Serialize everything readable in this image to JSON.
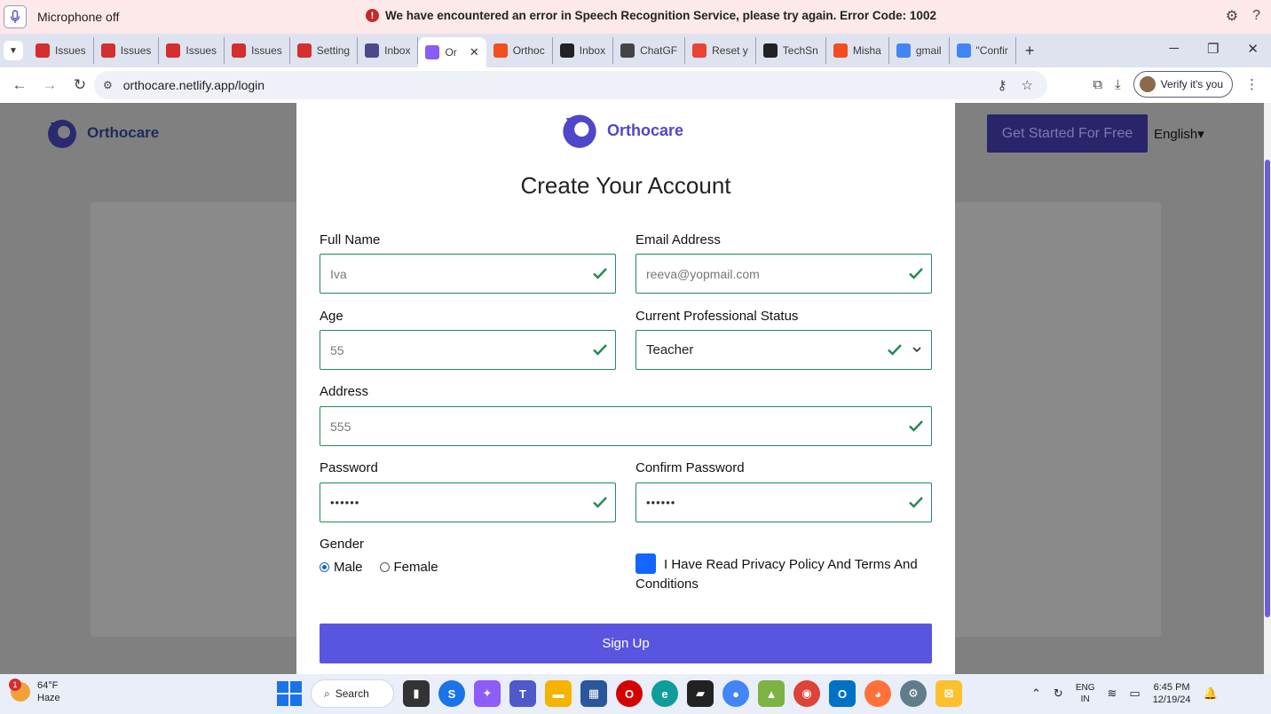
{
  "speech": {
    "mic_label": "Microphone off",
    "error_message": "We have encountered an error in Speech Recognition Service, please try again. Error Code: 1002",
    "error_badge": "!",
    "help_label": "?"
  },
  "tabs": [
    {
      "label": "Issues",
      "icon": "issues-icon",
      "color": "#d32f2f"
    },
    {
      "label": "Issues",
      "icon": "issues-icon",
      "color": "#d32f2f"
    },
    {
      "label": "Issues",
      "icon": "issues-icon",
      "color": "#d32f2f"
    },
    {
      "label": "Issues",
      "icon": "issues-icon",
      "color": "#d32f2f"
    },
    {
      "label": "Setting",
      "icon": "issues-icon",
      "color": "#d32f2f"
    },
    {
      "label": "Inbox",
      "icon": "yahoo-icon",
      "color": "#4a4a8a"
    },
    {
      "label": "Or",
      "icon": "vite-icon",
      "color": "#8a5cf6",
      "active": true
    },
    {
      "label": "Orthoc",
      "icon": "figma-icon",
      "color": "#f24e1e"
    },
    {
      "label": "Inbox",
      "icon": "mail-icon",
      "color": "#222222"
    },
    {
      "label": "ChatGF",
      "icon": "chatgpt-icon",
      "color": "#444444"
    },
    {
      "label": "Reset y",
      "icon": "gmail-icon",
      "color": "#ea4335"
    },
    {
      "label": "TechSn",
      "icon": "techsn-icon",
      "color": "#222222"
    },
    {
      "label": "Misha",
      "icon": "figma-icon",
      "color": "#f24e1e"
    },
    {
      "label": "gmail",
      "icon": "google-icon",
      "color": "#4285f4"
    },
    {
      "label": "\"Confir",
      "icon": "google-icon",
      "color": "#4285f4"
    }
  ],
  "address": {
    "url": "orthocare.netlify.app/login",
    "verify_label": "Verify it's you"
  },
  "background": {
    "brand": "Orthocare",
    "cta": "Get Started For Free",
    "language": "English"
  },
  "form": {
    "brand": "Orthocare",
    "title": "Create Your Account",
    "full_name": {
      "label": "Full Name",
      "value": "Iva"
    },
    "email": {
      "label": "Email Address",
      "value": "reeva@yopmail.com"
    },
    "age": {
      "label": "Age",
      "value": "55"
    },
    "status": {
      "label": "Current Professional Status",
      "value": "Teacher"
    },
    "address": {
      "label": "Address",
      "value": "555"
    },
    "password": {
      "label": "Password",
      "value": "••••••"
    },
    "confirm": {
      "label": "Confirm Password",
      "value": "••••••"
    },
    "gender": {
      "label": "Gender",
      "male": "Male",
      "female": "Female",
      "selected": "Male"
    },
    "terms": "I Have Read Privacy Policy And Terms And Conditions",
    "submit": "Sign Up"
  },
  "colors": {
    "brand_purple": "#4f47c9",
    "valid_green": "#218a53",
    "button": "#5a55e0"
  },
  "taskbar": {
    "temp": "64°F",
    "condition": "Haze",
    "search": "Search",
    "lang1": "ENG",
    "lang2": "IN",
    "time": "6:45 PM",
    "date": "12/19/24",
    "weather_badge": "1"
  }
}
